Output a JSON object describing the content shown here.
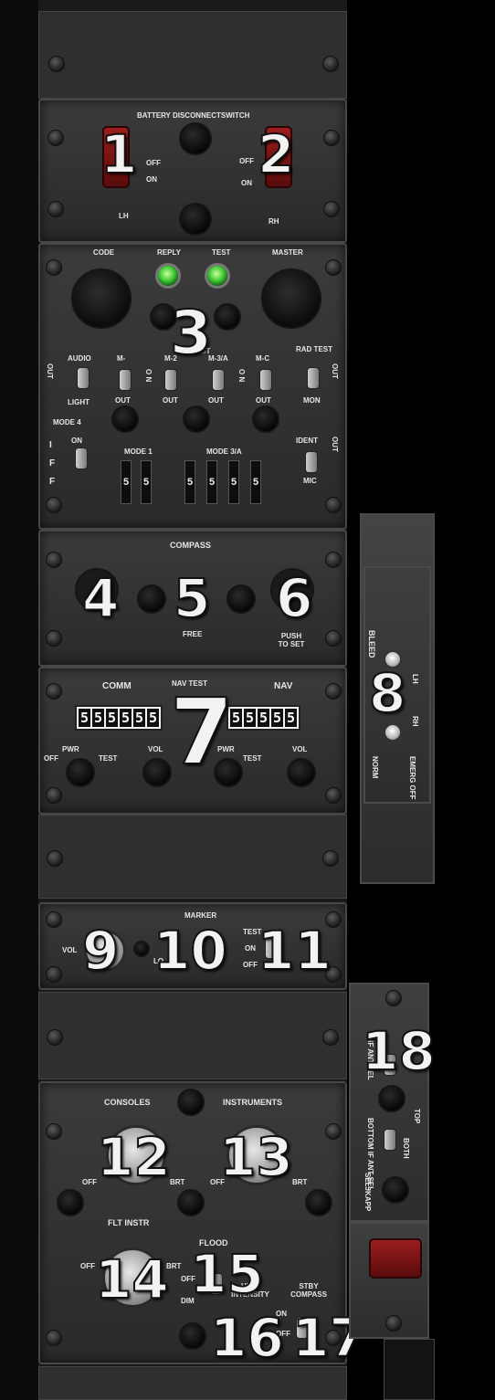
{
  "panels": {
    "battery": {
      "title": "BATTERY  DISCONNECTSWITCH",
      "off": "OFF",
      "on": "ON",
      "lh": "LH",
      "rh": "RH"
    },
    "iff": {
      "code": "CODE",
      "reply": "REPLY",
      "test": "TEST",
      "master": "MASTER",
      "audio": "AUDIO",
      "light": "LIGHT",
      "out": "OUT",
      "mode4": "MODE 4",
      "on": "ON",
      "iff_letters": [
        "I",
        "F",
        "F"
      ],
      "m1": "M-",
      "m2": "M-2",
      "m3": "M-3/A",
      "mc": "M-C",
      "test_label": "TEST",
      "rad_test": "RAD TEST",
      "mon": "MON",
      "o_n": "O N",
      "mode1": "MODE 1",
      "mode3a": "MODE 3/A",
      "ident": "IDENT",
      "mic": "MIC",
      "mode1_digits": [
        "5",
        "5"
      ],
      "mode3a_digits": [
        "5",
        "5",
        "5",
        "5"
      ]
    },
    "compass": {
      "title": "COMPASS",
      "free": "FREE",
      "push_to_set": "PUSH TO SET"
    },
    "radio": {
      "comm": "COMM",
      "nav_test": "NAV  TEST",
      "nav": "NAV",
      "comm_digits": [
        "5",
        "5",
        "5",
        "5",
        "5",
        "5"
      ],
      "nav_digits": [
        "5",
        "5",
        "5",
        "5",
        "5"
      ],
      "off": "OFF",
      "pwr": "PWR",
      "test": "TEST",
      "vol": "VOL"
    },
    "marker": {
      "title": "MARKER",
      "vol": "VOL",
      "lo": "LO",
      "test": "TEST",
      "on": "ON",
      "off": "OFF"
    },
    "lights": {
      "consoles": "CONSOLES",
      "instruments": "INSTRUMENTS",
      "off": "OFF",
      "brt": "BRT",
      "flt_instr": "FLT INSTR",
      "flood": "FLOOD",
      "dim": "DIM",
      "high_intensity": "HIGH INTENSITY",
      "stby_compass": "STBY COMPASS",
      "on": "ON"
    },
    "bleed": {
      "title": "BLEED",
      "lh": "LH",
      "rh": "RH",
      "norm": "NORM",
      "emerg_off": "EMERG OFF"
    },
    "antenna": {
      "uhf_ant_sel": "UHF ANT SEL",
      "bottom_if_ant_sel": "BOTTOM IF ANT SEL",
      "top": "TOP",
      "both": "BOTH",
      "seljkapp": "SELJKAPP"
    }
  },
  "callouts": [
    "1",
    "2",
    "3",
    "4",
    "5",
    "6",
    "7",
    "8",
    "9",
    "10",
    "11",
    "12",
    "13",
    "14",
    "15",
    "16",
    "17",
    "18"
  ],
  "colors": {
    "panel": "#2f2f2f",
    "guard_red": "#8b1a1a",
    "indicator_green": "#3cc832"
  }
}
